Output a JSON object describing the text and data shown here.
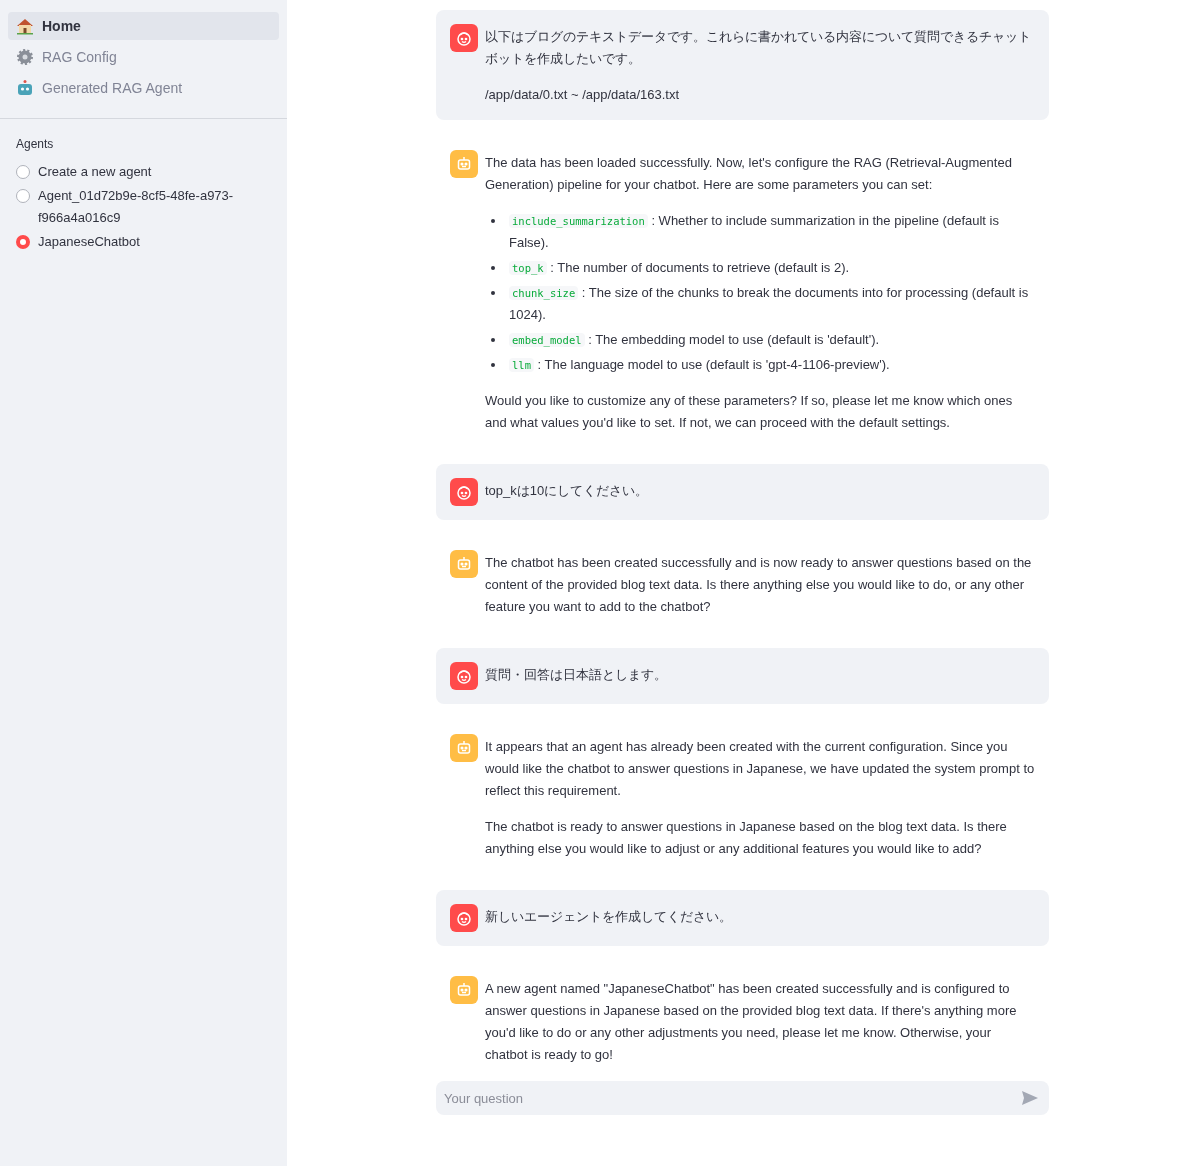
{
  "sidebar": {
    "nav": [
      {
        "label": "Home",
        "kind": "house",
        "selected": true
      },
      {
        "label": "RAG Config",
        "kind": "gear",
        "selected": false
      },
      {
        "label": "Generated RAG Agent",
        "kind": "robot",
        "selected": false
      }
    ],
    "agents": {
      "title": "Agents",
      "options": [
        {
          "label": "Create a new agent",
          "selected": false
        },
        {
          "label": "Agent_01d72b9e-8cf5-48fe-a973-f966a4a016c9",
          "selected": false
        },
        {
          "label": "JapaneseChatbot",
          "selected": true
        }
      ]
    }
  },
  "messages": [
    {
      "kind": "user",
      "blocks": [
        {
          "kind": "text",
          "text": "以下はブログのテキストデータです。これらに書かれている内容について質問できるチャットボットを作成したいです。"
        },
        {
          "kind": "text",
          "text": "/app/data/0.txt ~ /app/data/163.txt"
        }
      ]
    },
    {
      "kind": "assistant",
      "blocks": [
        {
          "kind": "text",
          "text": "The data has been loaded successfully. Now, let's configure the RAG (Retrieval-Augmented Generation) pipeline for your chatbot. Here are some parameters you can set:"
        },
        {
          "kind": "list",
          "items": [
            {
              "code": "include_summarization",
              "text": ": Whether to include summarization in the pipeline (default is False)."
            },
            {
              "code": "top_k",
              "text": ": The number of documents to retrieve (default is 2)."
            },
            {
              "code": "chunk_size",
              "text": ": The size of the chunks to break the documents into for processing (default is 1024)."
            },
            {
              "code": "embed_model",
              "text": ": The embedding model to use (default is 'default')."
            },
            {
              "code": "llm",
              "text": ": The language model to use (default is 'gpt-4-1106-preview')."
            }
          ]
        },
        {
          "kind": "text",
          "text": "Would you like to customize any of these parameters? If so, please let me know which ones and what values you'd like to set. If not, we can proceed with the default settings."
        }
      ]
    },
    {
      "kind": "user",
      "blocks": [
        {
          "kind": "text",
          "text": "top_kは10にしてください。"
        }
      ]
    },
    {
      "kind": "assistant",
      "blocks": [
        {
          "kind": "text",
          "text": "The chatbot has been created successfully and is now ready to answer questions based on the content of the provided blog text data. Is there anything else you would like to do, or any other feature you want to add to the chatbot?"
        }
      ]
    },
    {
      "kind": "user",
      "blocks": [
        {
          "kind": "text",
          "text": "質問・回答は日本語とします。"
        }
      ]
    },
    {
      "kind": "assistant",
      "blocks": [
        {
          "kind": "text",
          "text": "It appears that an agent has already been created with the current configuration. Since you would like the chatbot to answer questions in Japanese, we have updated the system prompt to reflect this requirement."
        },
        {
          "kind": "text",
          "text": "The chatbot is ready to answer questions in Japanese based on the blog text data. Is there anything else you would like to adjust or any additional features you would like to add?"
        }
      ]
    },
    {
      "kind": "user",
      "blocks": [
        {
          "kind": "text",
          "text": "新しいエージェントを作成してください。"
        }
      ]
    },
    {
      "kind": "assistant",
      "blocks": [
        {
          "kind": "text",
          "text": "A new agent named \"JapaneseChatbot\" has been created successfully and is configured to answer questions in Japanese based on the provided blog text data. If there's anything more you'd like to do or any other adjustments you need, please let me know. Otherwise, your chatbot is ready to go!"
        }
      ]
    }
  ],
  "chat_input": {
    "placeholder": "Your question"
  }
}
